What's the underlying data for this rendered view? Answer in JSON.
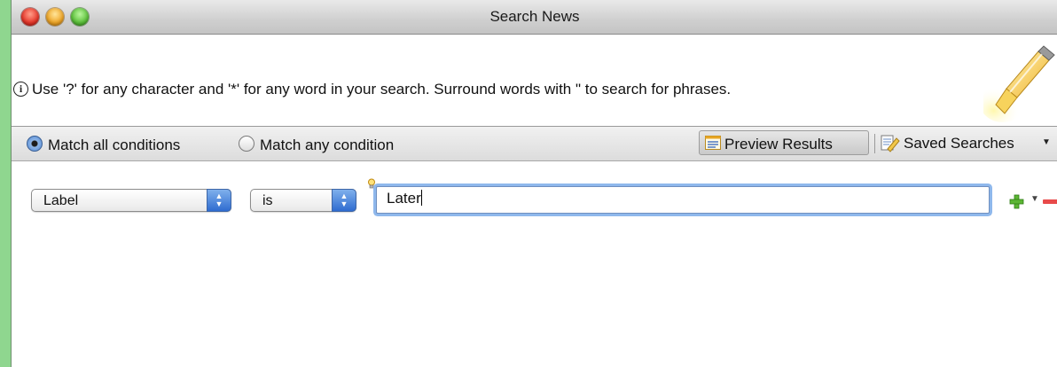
{
  "window": {
    "title": "Search News"
  },
  "banner": {
    "info_icon": "info-circle-icon",
    "text": "Use '?' for any character and '*' for any word in your search. Surround words with \" to search for phrases.",
    "decoration_icon": "highlighter-icon"
  },
  "toolbar": {
    "match_all_label": "Match all conditions",
    "match_any_label": "Match any condition",
    "match_selected": "all",
    "preview_label": "Preview Results",
    "saved_label": "Saved Searches"
  },
  "condition": {
    "field": "Label",
    "operator": "is",
    "value": "Later"
  },
  "colors": {
    "background": "#8fd68f",
    "focus_ring": "#8fb8ec",
    "add": "#5bb533",
    "remove": "#e84a4a"
  }
}
